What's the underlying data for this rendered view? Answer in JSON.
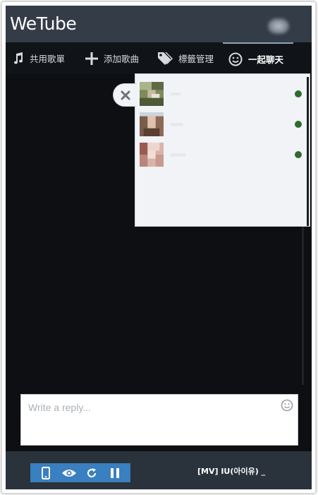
{
  "app": {
    "title": "WeTube"
  },
  "nav": {
    "items": [
      {
        "label": "共用歌單",
        "icon": "music-note-icon"
      },
      {
        "label": "添加歌曲",
        "icon": "plus-icon"
      },
      {
        "label": "標籤管理",
        "icon": "tag-icon"
      },
      {
        "label": "一起聊天",
        "icon": "smiley-icon",
        "active": true
      }
    ]
  },
  "online_users": {
    "users": [
      {
        "name": "····",
        "status": "online"
      },
      {
        "name": "·····",
        "status": "online"
      },
      {
        "name": "······",
        "status": "online"
      }
    ],
    "status_color": "#2f6b2f"
  },
  "reply": {
    "placeholder": "Write a reply..."
  },
  "player": {
    "controls": [
      "mobile-icon",
      "eye-icon",
      "refresh-icon",
      "pause-icon"
    ],
    "now_playing": "[MV] IU(아이유) _"
  },
  "colors": {
    "titlebar": "#333c47",
    "controls_bg": "#3a7fbf",
    "panel_bg": "#f1f3f7"
  }
}
